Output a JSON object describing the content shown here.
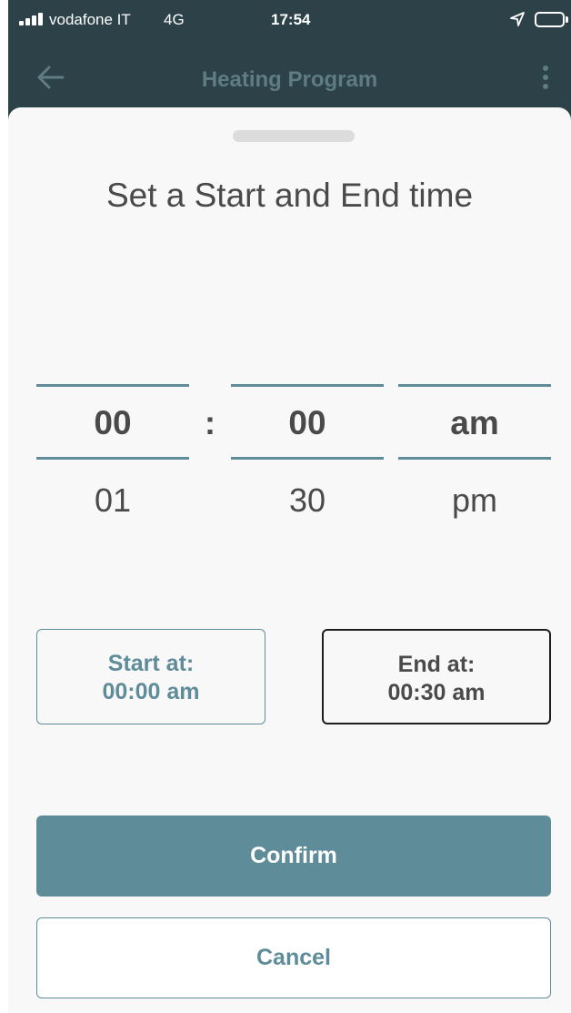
{
  "status_bar": {
    "carrier": "vodafone IT",
    "network": "4G",
    "time": "17:54",
    "icons": [
      "signal-icon",
      "location-icon",
      "battery-icon"
    ]
  },
  "nav": {
    "title": "Heating Program",
    "icons": [
      "back-arrow-icon",
      "more-vertical-icon"
    ]
  },
  "sheet": {
    "title": "Set a Start and End time"
  },
  "picker": {
    "separator": ":",
    "hour": {
      "selected": "00",
      "next": "01"
    },
    "minute": {
      "selected": "00",
      "next": "30"
    },
    "period": {
      "selected": "am",
      "next": "pm"
    }
  },
  "start_box": {
    "label": "Start at:",
    "value": "00:00 am"
  },
  "end_box": {
    "label": "End at:",
    "value": "00:30 am"
  },
  "buttons": {
    "confirm": "Confirm",
    "cancel": "Cancel"
  },
  "colors": {
    "accent": "#5f8c99",
    "header_bg": "#2c4248",
    "sheet_bg": "#f8f8f8",
    "text": "#4a4a4a"
  }
}
